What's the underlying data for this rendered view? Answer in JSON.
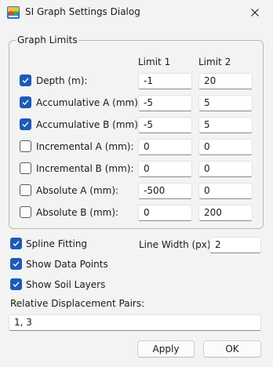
{
  "window": {
    "title": "SI Graph Settings Dialog",
    "icon": "app-icon",
    "close_icon": "close-icon"
  },
  "graph_limits": {
    "title": "Graph Limits",
    "col1": "Limit 1",
    "col2": "Limit 2",
    "rows": [
      {
        "label": "Depth (m):",
        "checked": true,
        "limit1": "-1",
        "limit2": "20"
      },
      {
        "label": "Accumulative A (mm):",
        "checked": true,
        "limit1": "-5",
        "limit2": "5"
      },
      {
        "label": "Accumulative B (mm):",
        "checked": true,
        "limit1": "-5",
        "limit2": "5"
      },
      {
        "label": "Incremental A (mm):",
        "checked": false,
        "limit1": "0",
        "limit2": "0"
      },
      {
        "label": "Incremental B (mm):",
        "checked": false,
        "limit1": "0",
        "limit2": "0"
      },
      {
        "label": "Absolute A (mm):",
        "checked": false,
        "limit1": "-500",
        "limit2": "0"
      },
      {
        "label": "Absolute B (mm):",
        "checked": false,
        "limit1": "0",
        "limit2": "200"
      }
    ]
  },
  "options": {
    "spline": {
      "label": "Spline Fitting",
      "checked": true
    },
    "data_points": {
      "label": "Show Data Points",
      "checked": true
    },
    "soil_layers": {
      "label": "Show Soil Layers",
      "checked": true
    },
    "line_width_label": "Line Width (px):",
    "line_width_value": "2"
  },
  "pairs": {
    "label": "Relative Displacement Pairs:",
    "value": "1, 3"
  },
  "buttons": {
    "apply": "Apply",
    "ok": "OK"
  },
  "colors": {
    "accent": "#1d5ab7",
    "window_bg": "#f3f3f3"
  }
}
